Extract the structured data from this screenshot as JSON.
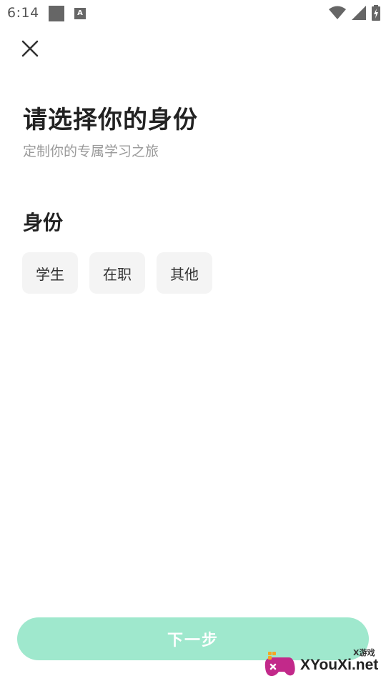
{
  "status_bar": {
    "time": "6:14",
    "icons": [
      "notification-square-icon",
      "a-app-icon",
      "wifi-icon",
      "signal-icon",
      "battery-charging-icon"
    ]
  },
  "close": {
    "icon": "close-icon"
  },
  "header": {
    "title": "请选择你的身份",
    "subtitle": "定制你的专属学习之旅"
  },
  "identity": {
    "section_title": "身份",
    "options": [
      {
        "label": "学生"
      },
      {
        "label": "在职"
      },
      {
        "label": "其他"
      }
    ]
  },
  "footer": {
    "next_label": "下一步"
  },
  "watermark": {
    "small_text": "X游戏",
    "main_text": "XYouXi.net"
  },
  "colors": {
    "next_button_bg": "#9fe8cd",
    "chip_bg": "#f4f4f4",
    "title": "#222222",
    "subtitle": "#9a9a9a"
  }
}
